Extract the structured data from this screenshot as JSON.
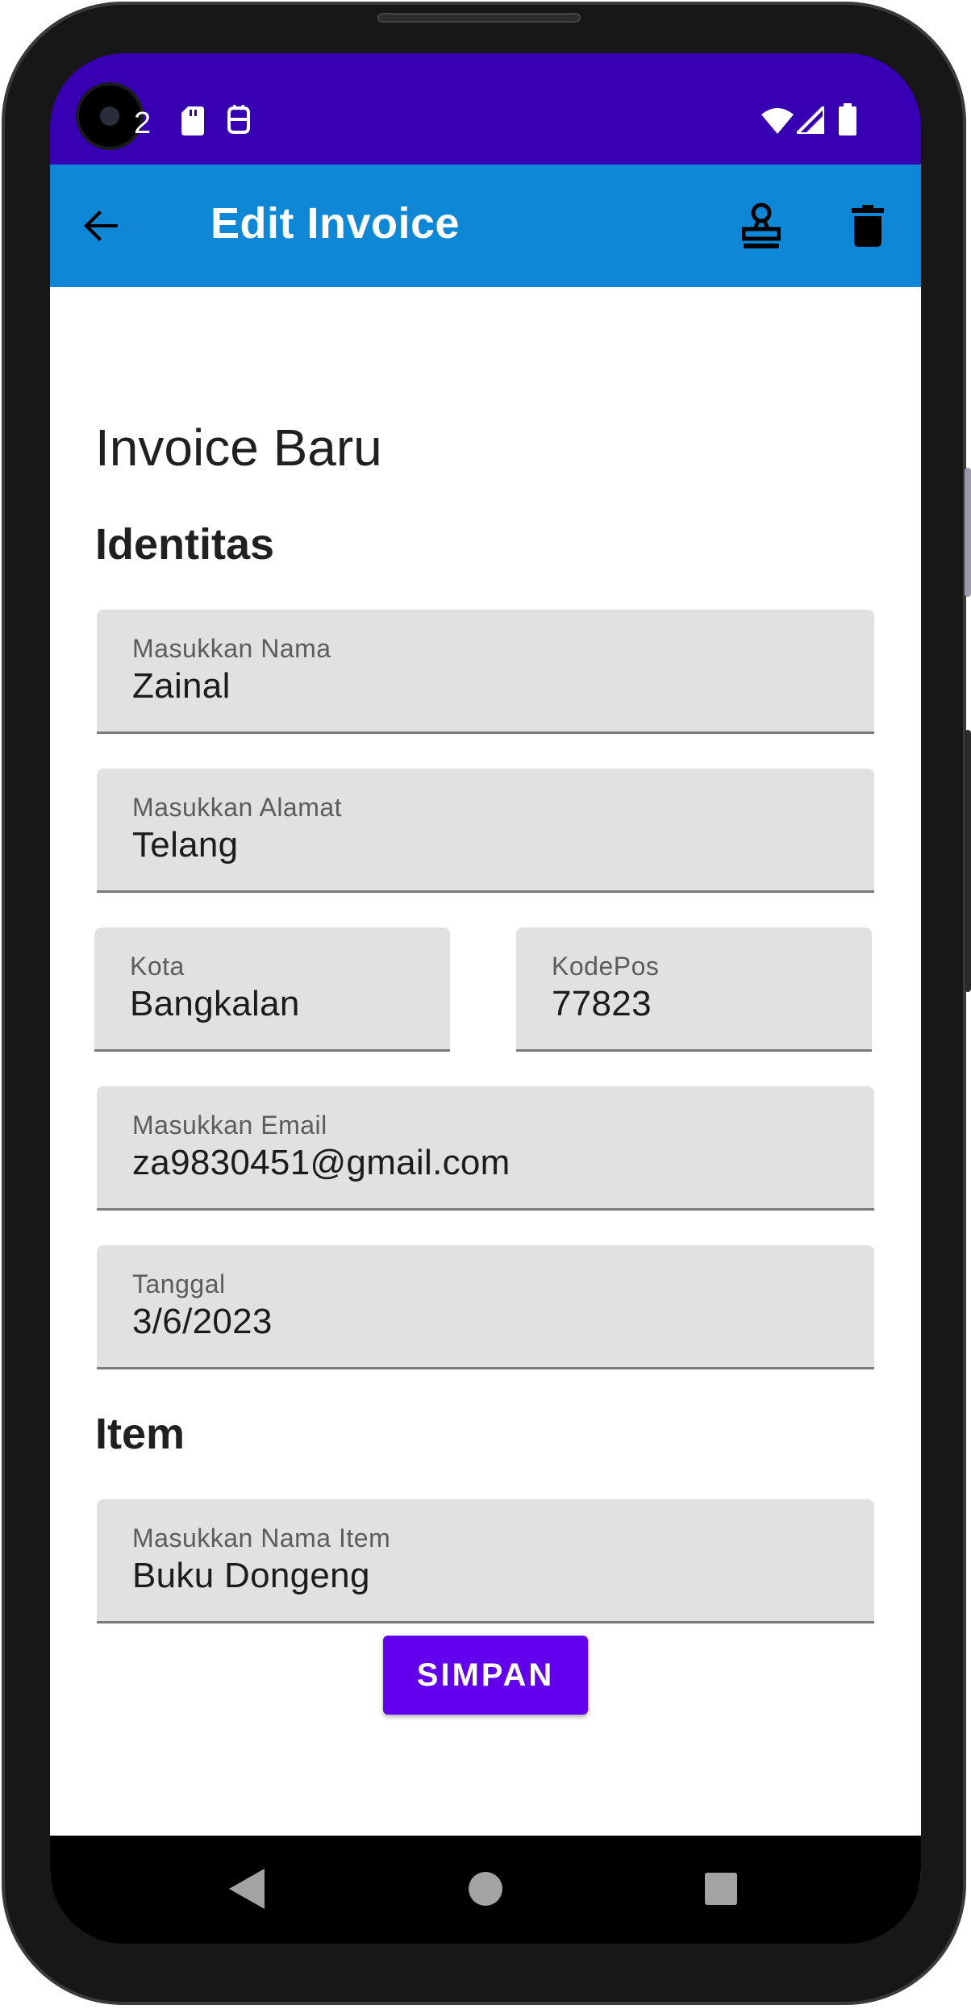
{
  "status_bar": {
    "notification_count": "2",
    "left_icons": [
      "sd-card-icon",
      "notification-app-icon"
    ],
    "right_icons": [
      "wifi-icon",
      "signal-icon",
      "battery-icon"
    ]
  },
  "app_bar": {
    "title": "Edit Invoice",
    "icons": [
      "back-arrow-icon",
      "stamp-icon",
      "trash-icon"
    ],
    "color": "#0d87d6"
  },
  "main": {
    "page_title": "Invoice Baru",
    "section_identity": "Identitas",
    "fields": {
      "name": {
        "label": "Masukkan Nama",
        "value": "Zainal"
      },
      "address": {
        "label": "Masukkan Alamat",
        "value": "Telang"
      },
      "city": {
        "label": "Kota",
        "value": "Bangkalan"
      },
      "postal_code": {
        "label": "KodePos",
        "value": "77823"
      },
      "email": {
        "label": "Masukkan Email",
        "value": "za9830451@gmail.com"
      },
      "date": {
        "label": "Tanggal",
        "value": "3/6/2023"
      },
      "item_name": {
        "label": "Masukkan Nama Item",
        "value": "Buku Dongeng"
      }
    },
    "section_item": "Item",
    "save_button": "SIMPAN",
    "save_button_color": "#6200ee"
  },
  "nav_bar": {
    "icons": [
      "back-triangle-icon",
      "home-circle-icon",
      "recents-square-icon"
    ]
  },
  "colors": {
    "status_bar": "#3700b3",
    "field_background": "#e1e1e1"
  }
}
